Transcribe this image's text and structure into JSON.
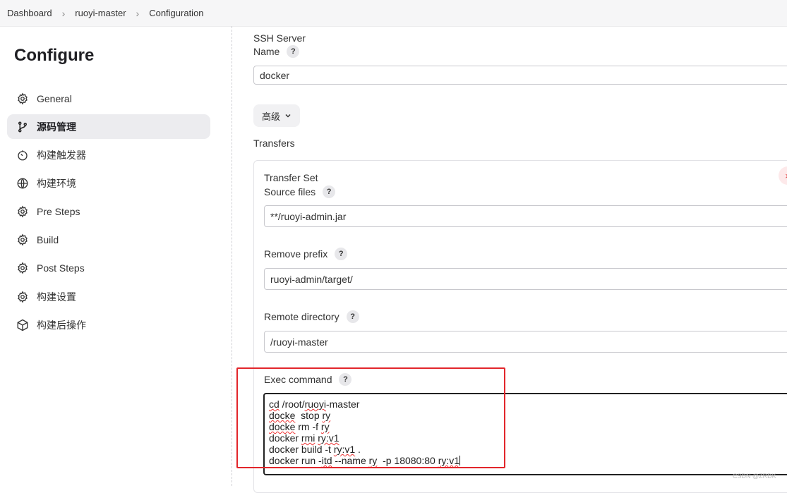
{
  "breadcrumb": {
    "items": [
      "Dashboard",
      "ruoyi-master",
      "Configuration"
    ]
  },
  "sidebar": {
    "title": "Configure",
    "items": [
      {
        "label": "General",
        "icon": "gear-icon"
      },
      {
        "label": "源码管理",
        "icon": "branch-icon"
      },
      {
        "label": "构建触发器",
        "icon": "timer-icon"
      },
      {
        "label": "构建环境",
        "icon": "globe-icon"
      },
      {
        "label": "Pre Steps",
        "icon": "gear-icon"
      },
      {
        "label": "Build",
        "icon": "gear-icon"
      },
      {
        "label": "Post Steps",
        "icon": "gear-icon"
      },
      {
        "label": "构建设置",
        "icon": "gear-icon"
      },
      {
        "label": "构建后操作",
        "icon": "cube-icon"
      }
    ],
    "active_index": 1
  },
  "ssh_server": {
    "section_label": "SSH Server",
    "name_label": "Name",
    "name_value": "docker",
    "advanced_label": "高级"
  },
  "transfers": {
    "label": "Transfers",
    "set_label": "Transfer Set",
    "source_files_label": "Source files",
    "source_files_value": "**/ruoyi-admin.jar",
    "remove_prefix_label": "Remove prefix",
    "remove_prefix_value": "ruoyi-admin/target/",
    "remote_directory_label": "Remote directory",
    "remote_directory_value": "/ruoyi-master",
    "exec_command_label": "Exec command",
    "exec_command_lines": [
      "cd /root/ruoyi-master",
      "docke  stop ry",
      "docke rm -f ry",
      "docker rmi ry:v1",
      "docker build -t ry:v1 .",
      "docker run -itd --name ry  -p 18080:80 ry:v1"
    ]
  },
  "help_symbol": "?",
  "close_symbol": "×",
  "watermark": "CSDN @ZRDK",
  "colors": {
    "highlight_box": "#e2262b",
    "active_nav_bg": "#ececef"
  }
}
